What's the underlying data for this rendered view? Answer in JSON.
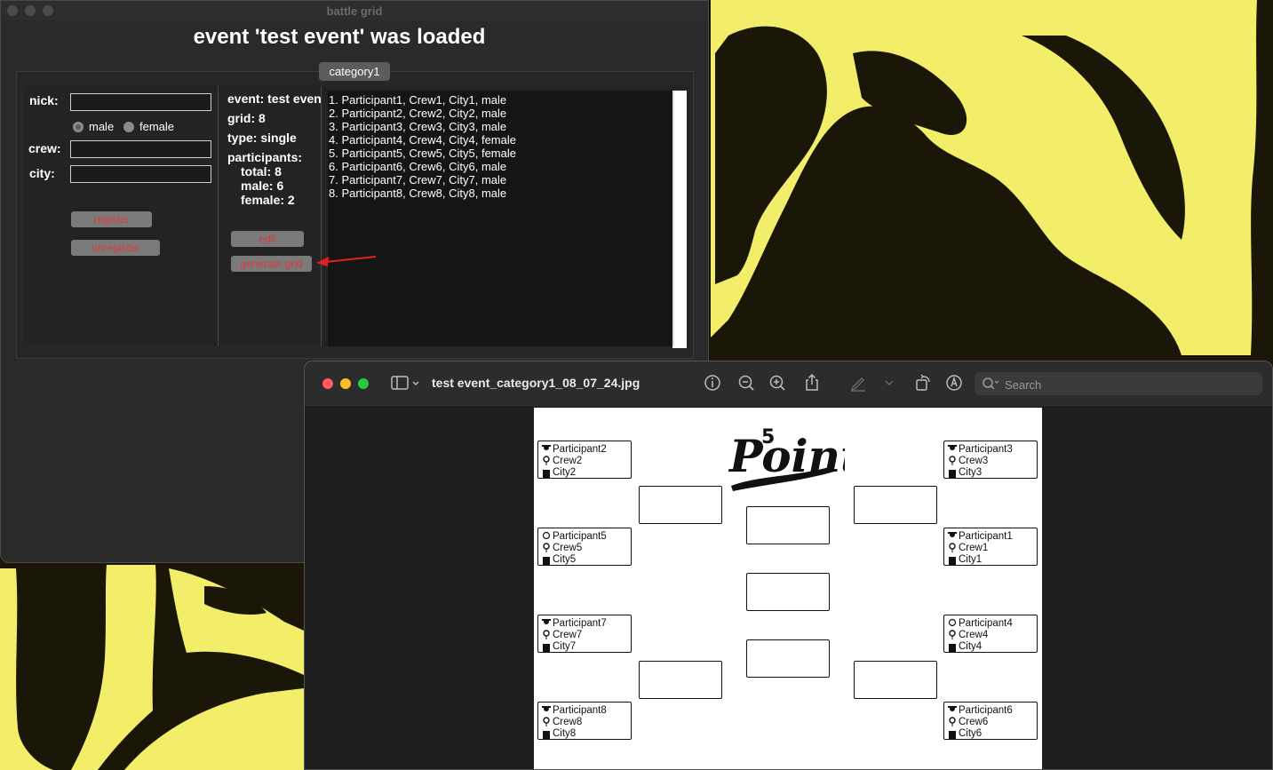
{
  "battle_grid": {
    "window_title": "battle grid",
    "heading": "event 'test event' was loaded",
    "tab_label": "category1",
    "form": {
      "nick_label": "nick:",
      "nick_value": "",
      "gender_options": [
        "male",
        "female"
      ],
      "crew_label": "crew:",
      "crew_value": "",
      "city_label": "city:",
      "city_value": "",
      "register_label": "register",
      "unregister_label": "unregister"
    },
    "info": {
      "event": "event: test event",
      "grid": "grid: 8",
      "type": "type: single",
      "participants_label": "participants:",
      "total": "total: 8",
      "male": "male: 6",
      "female": "female: 2"
    },
    "edit_label": "edit",
    "generate_label": "generate grid",
    "participants": [
      "1. Participant1, Crew1, City1, male",
      "2. Participant2, Crew2, City2, male",
      "3. Participant3, Crew3, City3, male",
      "4. Participant4, Crew4, City4, female",
      "5. Participant5, Crew5, City5, female",
      "6. Participant6, Crew6, City6, male",
      "7. Participant7, Crew7, City7, male",
      "8. Participant8, Crew8, City8, male"
    ]
  },
  "preview": {
    "filename": "test event_category1_08_07_24.jpg",
    "search_placeholder": "Search",
    "logo_text": "Points",
    "logo_number": "5",
    "left_slots": [
      {
        "name": "Participant2",
        "crew": "Crew2",
        "city": "City2",
        "gender": "male"
      },
      {
        "name": "Participant5",
        "crew": "Crew5",
        "city": "City5",
        "gender": "female"
      },
      {
        "name": "Participant7",
        "crew": "Crew7",
        "city": "City7",
        "gender": "male"
      },
      {
        "name": "Participant8",
        "crew": "Crew8",
        "city": "City8",
        "gender": "male"
      }
    ],
    "right_slots": [
      {
        "name": "Participant3",
        "crew": "Crew3",
        "city": "City3",
        "gender": "male"
      },
      {
        "name": "Participant1",
        "crew": "Crew1",
        "city": "City1",
        "gender": "male"
      },
      {
        "name": "Participant4",
        "crew": "Crew4",
        "city": "City4",
        "gender": "female"
      },
      {
        "name": "Participant6",
        "crew": "Crew6",
        "city": "City6",
        "gender": "male"
      }
    ]
  },
  "colors": {
    "wallpaper_yellow": "#f2ee6a",
    "wallpaper_dark": "#1a1608",
    "button_text_red": "#e03a3a",
    "arrow_red": "#e02020",
    "close_red": "#ff5f57",
    "minimize_yellow": "#febc2e",
    "zoom_green": "#28c840"
  }
}
